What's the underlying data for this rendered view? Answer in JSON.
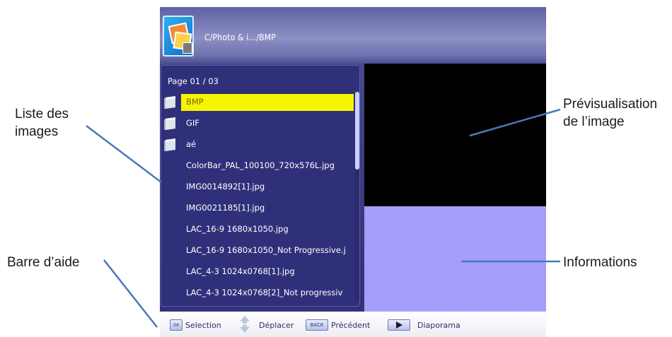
{
  "annotations": {
    "file_list_label_line1": "Liste des",
    "file_list_label_line2": "images",
    "preview_label_line1": "Prévisualisation",
    "preview_label_line2": "de l’image",
    "help_bar_label": "Barre d’aide",
    "info_label": "Informations"
  },
  "header": {
    "path": "C/Photo & i.../BMP",
    "icon": "photo-folder-icon"
  },
  "browser": {
    "page_label": "Page  01 / 03",
    "items": [
      {
        "name": "BMP",
        "type": "folder",
        "selected": true
      },
      {
        "name": "GIF",
        "type": "folder",
        "selected": false
      },
      {
        "name": "aé",
        "type": "folder",
        "selected": false
      },
      {
        "name": "ColorBar_PAL_100100_720x576L.jpg",
        "type": "file",
        "selected": false
      },
      {
        "name": "IMG0014892[1].jpg",
        "type": "file",
        "selected": false
      },
      {
        "name": "IMG0021185[1].jpg",
        "type": "file",
        "selected": false
      },
      {
        "name": "LAC_16-9 1680x1050.jpg",
        "type": "file",
        "selected": false
      },
      {
        "name": "LAC_16-9 1680x1050_Not Progressive.j",
        "type": "file",
        "selected": false
      },
      {
        "name": "LAC_4-3 1024x0768[1].jpg",
        "type": "file",
        "selected": false
      },
      {
        "name": "LAC_4-3 1024x0768[2]_Not progressiv",
        "type": "file",
        "selected": false
      }
    ]
  },
  "help_bar": {
    "ok_key": "OK",
    "selection_label": "Selection",
    "move_label": "Déplacer",
    "back_key": "BACK",
    "previous_label": "Précédent",
    "slideshow_label": "Diaporama"
  },
  "colors": {
    "selection_highlight": "#f6f500",
    "info_panel": "#a59dfa",
    "preview_panel": "#000000",
    "list_background": "#30307a"
  }
}
